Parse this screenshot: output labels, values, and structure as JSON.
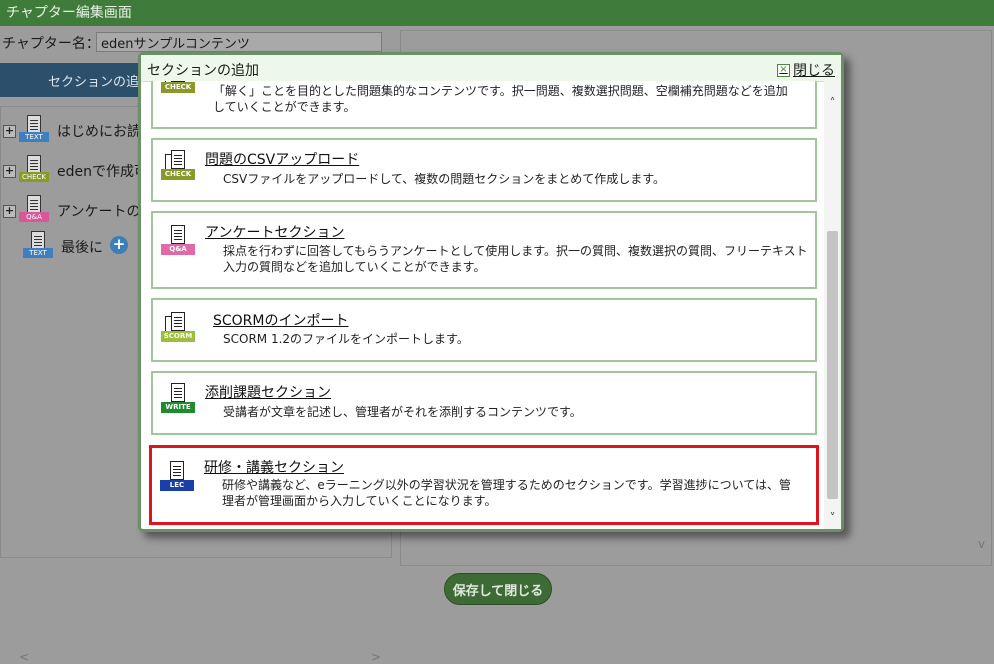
{
  "page": {
    "title": "チャプター編集画面",
    "chapter_label": "チャプター名：",
    "chapter_value": "edenサンプルコンテンツ",
    "add_section_button": "セクションの追",
    "save_button": "保存して閉じる"
  },
  "tree": {
    "items": [
      {
        "label": "はじめにお読",
        "tag": "TEXT",
        "tag_color": "#3f7fbf"
      },
      {
        "label": "edenで作成可",
        "tag": "CHECK",
        "tag_color": "#8a9a2a"
      },
      {
        "label": "アンケートの",
        "tag": "Q&A",
        "tag_color": "#d9589a"
      },
      {
        "label": "最後に",
        "tag": "TEXT",
        "tag_color": "#3f7fbf"
      }
    ]
  },
  "modal": {
    "title": "セクションの追加",
    "close_label": "閉じる",
    "cards": [
      {
        "title": "",
        "desc": "「解く」ことを目的とした問題集的なコンテンツです。択一問題、複数選択問題、空欄補充問題などを追加\nしていくことができます。",
        "tag": "CHECK",
        "tag_color": "#8a9a2a"
      },
      {
        "title": "問題のCSVアップロード",
        "desc": "CSVファイルをアップロードして、複数の問題セクションをまとめて作成します。",
        "tag": "CHECK",
        "tag_color": "#8a9a2a"
      },
      {
        "title": "アンケートセクション",
        "desc": "採点を行わずに回答してもらうアンケートとして使用します。択一の質問、複数選択の質問、フリーテキスト\n入力の質問などを追加していくことができます。",
        "tag": "Q&A",
        "tag_color": "#e06aa8"
      },
      {
        "title": "SCORMのインポート",
        "desc": "SCORM 1.2のファイルをインポートします。",
        "tag": "SCORM",
        "tag_color": "#9bbf3a"
      },
      {
        "title": "添削課題セクション",
        "desc": "受講者が文章を記述し、管理者がそれを添削するコンテンツです。",
        "tag": "WRITE",
        "tag_color": "#1f8a2e"
      },
      {
        "title": "研修・講義セクション",
        "desc": "研修や講義など、eラーニング以外の学習状況を管理するためのセクションです。学習進捗については、管\n理者が管理画面から入力していくことになります。",
        "tag": "LEC",
        "tag_color": "#1a3fa8"
      }
    ]
  },
  "icons": {
    "close": "close-x-icon",
    "scroll_up": "chevron-up-icon",
    "scroll_down": "chevron-down-icon"
  }
}
